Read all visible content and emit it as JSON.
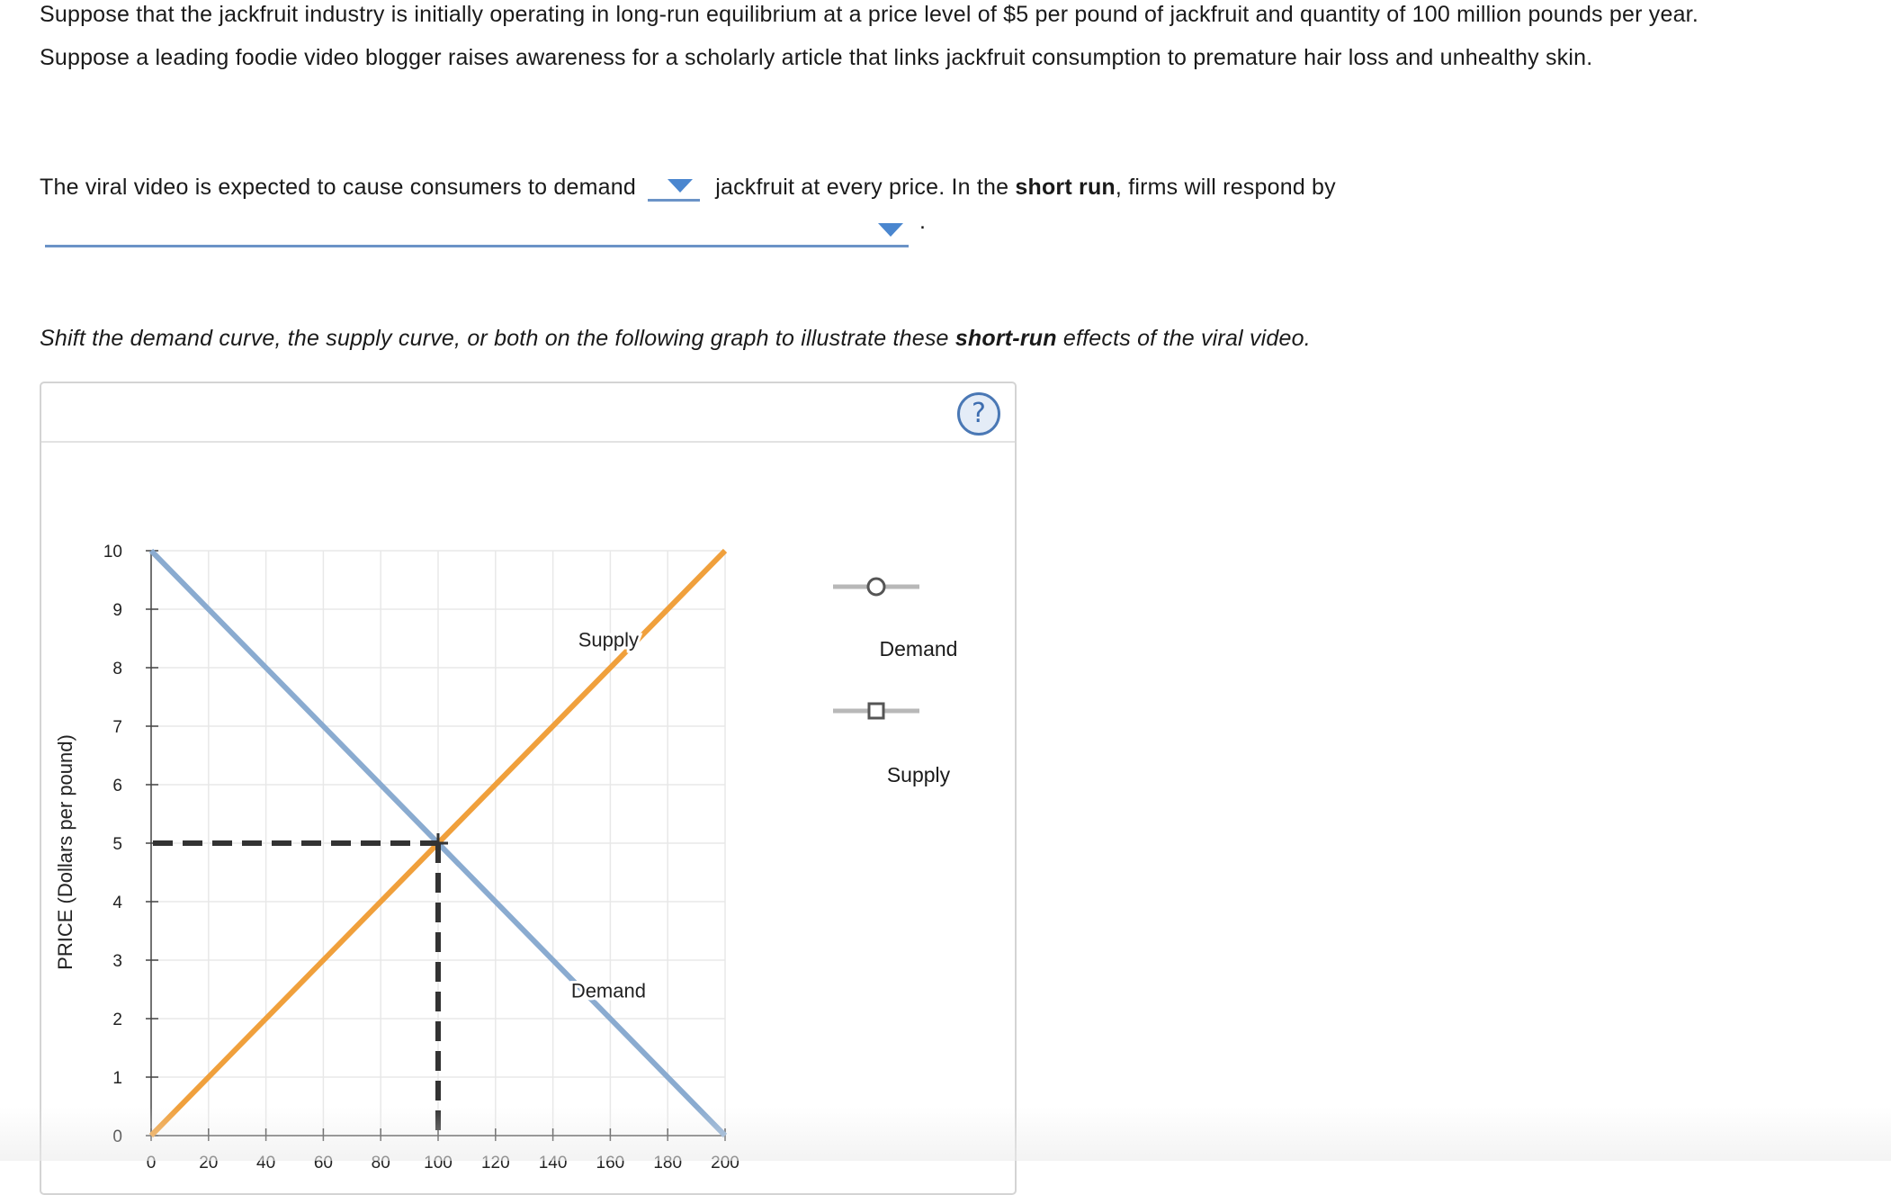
{
  "intro": "Suppose that the jackfruit industry is initially operating in long-run equilibrium at a price level of $5 per pound of jackfruit and quantity of 100 million pounds per year. Suppose a leading foodie video blogger raises awareness for a scholarly article that links jackfruit consumption to premature hair loss and unhealthy skin.",
  "question": {
    "part1": "The viral video is expected to cause consumers to demand",
    "part2": "jackfruit at every price. In the",
    "part2_bold": "short run",
    "part3": ", firms will respond by",
    "period": ".",
    "demand_dropdown_value": "",
    "respond_dropdown_value": ""
  },
  "instruction": {
    "part1": "Shift the demand curve, the supply curve, or both on the following graph to illustrate these",
    "bold": "short-run",
    "part2": "effects of the viral video."
  },
  "graph": {
    "help_label": "?",
    "ylabel": "PRICE (Dollars per pound)",
    "legend": {
      "demand": "Demand",
      "supply": "Supply"
    },
    "curve_labels": {
      "demand": "Demand",
      "supply": "Supply"
    },
    "colors": {
      "demand": "#8aabd0",
      "supply": "#f0a03c",
      "guide": "#333333",
      "grid": "#e8e8e8"
    }
  },
  "chart_data": {
    "type": "line",
    "xlim": [
      0,
      200
    ],
    "ylim": [
      0,
      10
    ],
    "x_ticks": [
      0,
      20,
      40,
      60,
      80,
      100,
      120,
      140,
      160,
      180,
      200
    ],
    "y_ticks": [
      0,
      1,
      2,
      3,
      4,
      5,
      6,
      7,
      8,
      9,
      10
    ],
    "ylabel": "PRICE (Dollars per pound)",
    "series": [
      {
        "name": "Demand",
        "x": [
          0,
          200
        ],
        "y": [
          10,
          0
        ]
      },
      {
        "name": "Supply",
        "x": [
          0,
          200
        ],
        "y": [
          0,
          10
        ]
      }
    ],
    "equilibrium": {
      "x": 100,
      "y": 5
    }
  }
}
